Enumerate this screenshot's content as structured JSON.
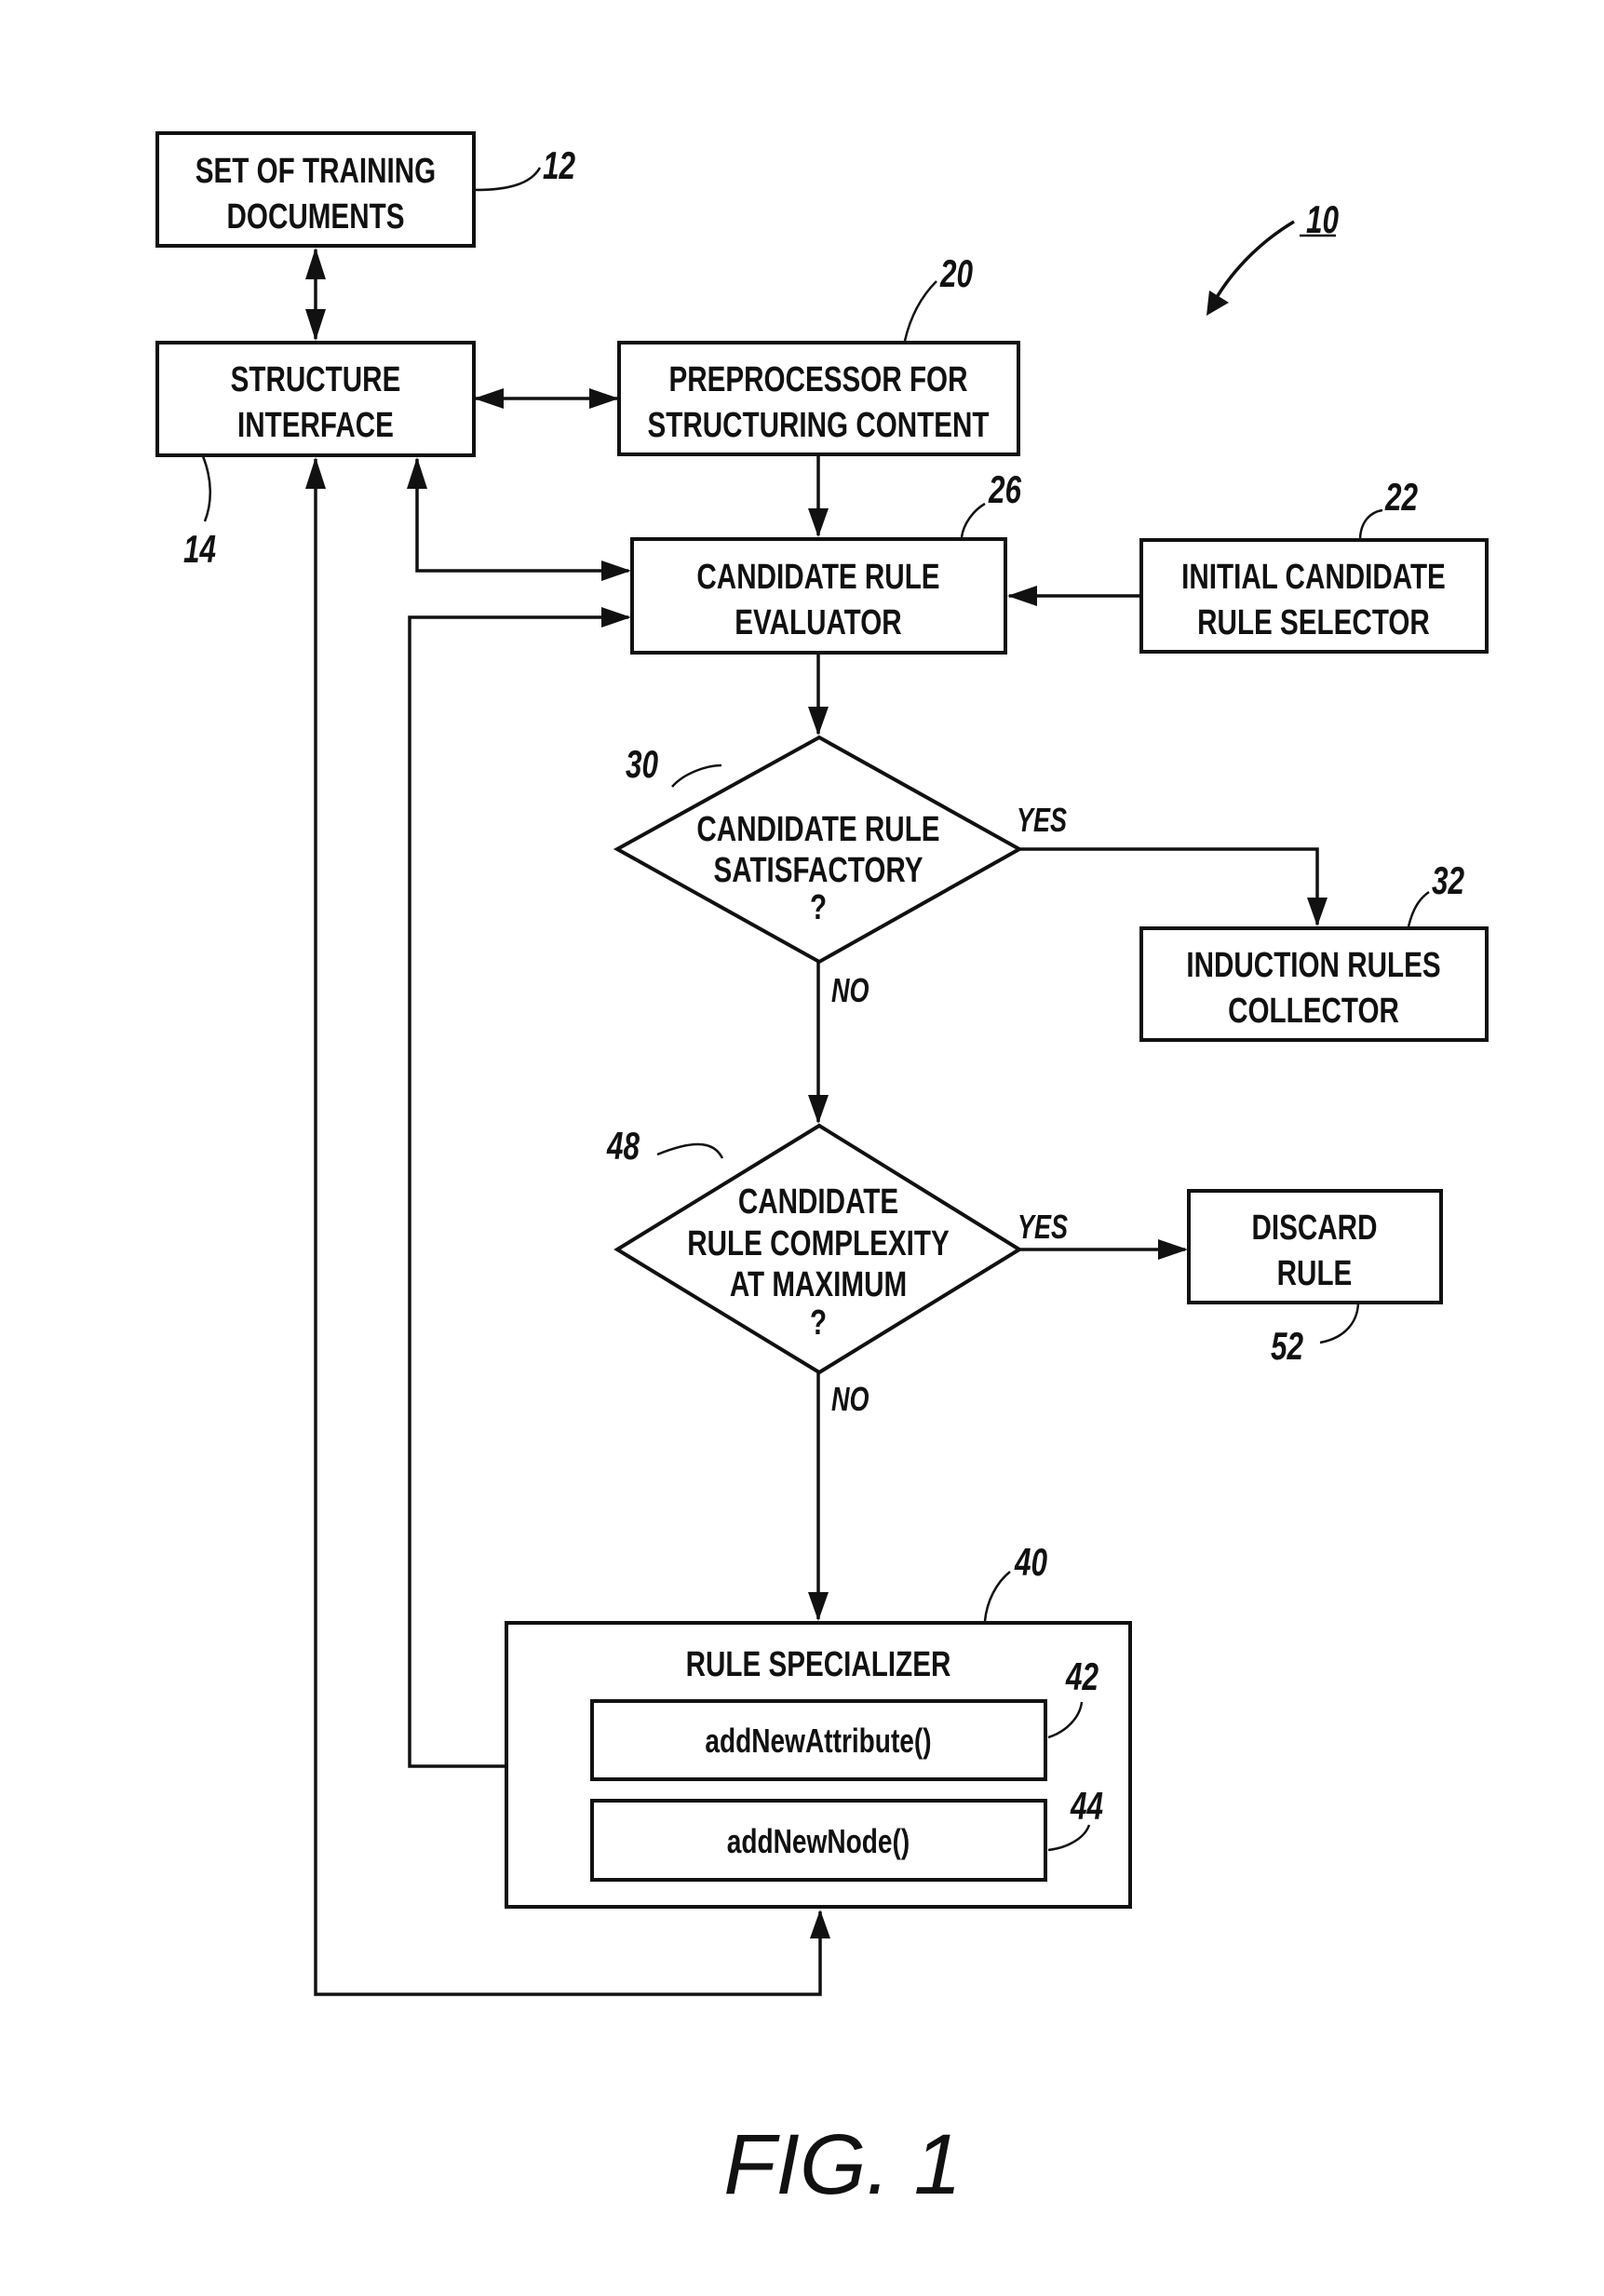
{
  "figure": {
    "caption": "FIG. 1",
    "system_ref": "10"
  },
  "nodes": {
    "training_documents": {
      "lines": [
        "SET OF TRAINING",
        "DOCUMENTS"
      ],
      "ref": "12"
    },
    "structure_interface": {
      "lines": [
        "STRUCTURE",
        "INTERFACE"
      ],
      "ref": "14"
    },
    "preprocessor": {
      "lines": [
        "PREPROCESSOR FOR",
        "STRUCTURING CONTENT"
      ],
      "ref": "20"
    },
    "candidate_rule_evaluator": {
      "lines": [
        "CANDIDATE RULE",
        "EVALUATOR"
      ],
      "ref": "26"
    },
    "initial_candidate_rule_selector": {
      "lines": [
        "INITIAL CANDIDATE",
        "RULE SELECTOR"
      ],
      "ref": "22"
    },
    "decision_satisfactory": {
      "lines": [
        "CANDIDATE RULE",
        "SATISFACTORY",
        "?"
      ],
      "ref": "30",
      "yes_label": "YES",
      "no_label": "NO"
    },
    "induction_rules_collector": {
      "lines": [
        "INDUCTION RULES",
        "COLLECTOR"
      ],
      "ref": "32"
    },
    "decision_complexity": {
      "lines": [
        "CANDIDATE",
        "RULE COMPLEXITY",
        "AT MAXIMUM",
        "?"
      ],
      "ref": "48",
      "yes_label": "YES",
      "no_label": "NO"
    },
    "discard_rule": {
      "lines": [
        "DISCARD",
        "RULE"
      ],
      "ref": "52"
    },
    "rule_specializer": {
      "title": "RULE SPECIALIZER",
      "ref": "40"
    },
    "add_new_attribute": {
      "label": "addNewAttribute()",
      "ref": "42"
    },
    "add_new_node": {
      "label": "addNewNode()",
      "ref": "44"
    }
  },
  "edges": [
    {
      "from": "training_documents",
      "to": "structure_interface",
      "type": "bidirectional"
    },
    {
      "from": "structure_interface",
      "to": "preprocessor",
      "type": "bidirectional"
    },
    {
      "from": "preprocessor",
      "to": "candidate_rule_evaluator",
      "type": "arrow"
    },
    {
      "from": "structure_interface",
      "to": "candidate_rule_evaluator",
      "type": "bidirectional"
    },
    {
      "from": "initial_candidate_rule_selector",
      "to": "candidate_rule_evaluator",
      "type": "arrow"
    },
    {
      "from": "candidate_rule_evaluator",
      "to": "decision_satisfactory",
      "type": "arrow"
    },
    {
      "from": "decision_satisfactory",
      "to": "induction_rules_collector",
      "type": "arrow",
      "label": "YES"
    },
    {
      "from": "decision_satisfactory",
      "to": "decision_complexity",
      "type": "arrow",
      "label": "NO"
    },
    {
      "from": "decision_complexity",
      "to": "discard_rule",
      "type": "arrow",
      "label": "YES"
    },
    {
      "from": "decision_complexity",
      "to": "rule_specializer",
      "type": "arrow",
      "label": "NO"
    },
    {
      "from": "rule_specializer",
      "to": "candidate_rule_evaluator",
      "type": "arrow"
    },
    {
      "from": "structure_interface",
      "to": "rule_specializer",
      "type": "bidirectional"
    }
  ]
}
